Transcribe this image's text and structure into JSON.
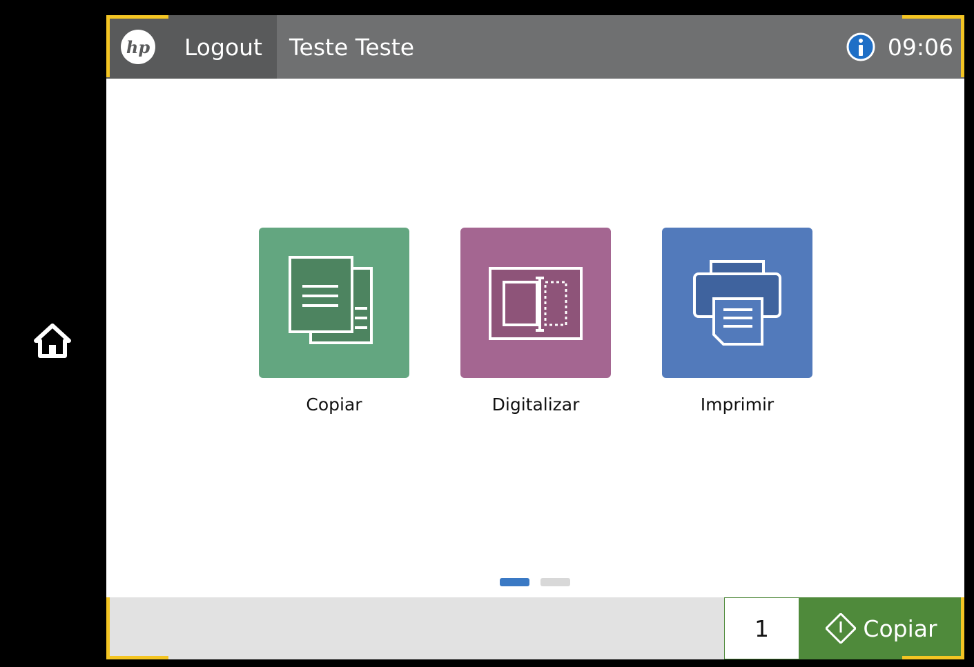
{
  "header": {
    "logo_text": "hp",
    "logout_label": "Logout",
    "user_name": "Teste Teste",
    "time": "09:06"
  },
  "apps": [
    {
      "label": "Copiar",
      "color": "#63a680",
      "icon": "copy-icon"
    },
    {
      "label": "Digitalizar",
      "color": "#a46691",
      "icon": "scan-icon"
    },
    {
      "label": "Imprimir",
      "color": "#527abb",
      "icon": "print-icon"
    }
  ],
  "pagination": {
    "pages": 2,
    "current": 1,
    "active_color": "#3a79c4",
    "inactive_color": "#d8d8d8"
  },
  "footer": {
    "copies": "1",
    "start_label": "Copiar",
    "start_color": "#4f8a3b"
  },
  "colors": {
    "topbar": "#6f7071",
    "topbar_dark": "#595a5b",
    "corner_accent": "#f4c523",
    "info_blue": "#1f6fc6"
  }
}
